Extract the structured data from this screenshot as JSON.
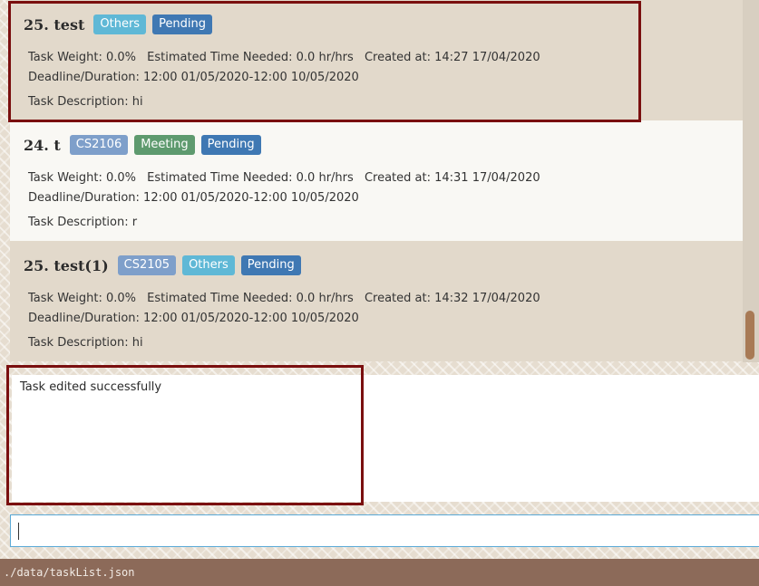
{
  "tasks": [
    {
      "title": "25.  test",
      "tags": [
        {
          "label": "Others",
          "kind": "others"
        },
        {
          "label": "Pending",
          "kind": "pending"
        }
      ],
      "weight": "Task Weight: 0.0%",
      "time_needed": "Estimated Time Needed: 0.0 hr/hrs",
      "created": "Created at: 14:27 17/04/2020",
      "deadline": "Deadline/Duration: 12:00 01/05/2020-12:00 10/05/2020",
      "description": "Task Description: hi"
    },
    {
      "title": "24.  t",
      "tags": [
        {
          "label": "CS2106",
          "kind": "module"
        },
        {
          "label": "Meeting",
          "kind": "meeting"
        },
        {
          "label": "Pending",
          "kind": "pending"
        }
      ],
      "weight": "Task Weight: 0.0%",
      "time_needed": "Estimated Time Needed: 0.0 hr/hrs",
      "created": "Created at: 14:31 17/04/2020",
      "deadline": "Deadline/Duration: 12:00 01/05/2020-12:00 10/05/2020",
      "description": "Task Description: r"
    },
    {
      "title": "25.  test(1)",
      "tags": [
        {
          "label": "CS2105",
          "kind": "module"
        },
        {
          "label": "Others",
          "kind": "others"
        },
        {
          "label": "Pending",
          "kind": "pending"
        }
      ],
      "weight": "Task Weight: 0.0%",
      "time_needed": "Estimated Time Needed: 0.0 hr/hrs",
      "created": "Created at: 14:32 17/04/2020",
      "deadline": "Deadline/Duration: 12:00 01/05/2020-12:00 10/05/2020",
      "description": "Task Description: hi"
    }
  ],
  "result": {
    "message": "Task edited successfully"
  },
  "command": {
    "value": ""
  },
  "status_bar": {
    "file_path": "./data/taskList.json"
  },
  "colors": {
    "highlight": "#7a0f0f",
    "status_bar": "#8c6a59",
    "pending": "#3f78b3",
    "others": "#5fb8d6",
    "meeting": "#5e9a6e",
    "module": "#7e9fca"
  }
}
